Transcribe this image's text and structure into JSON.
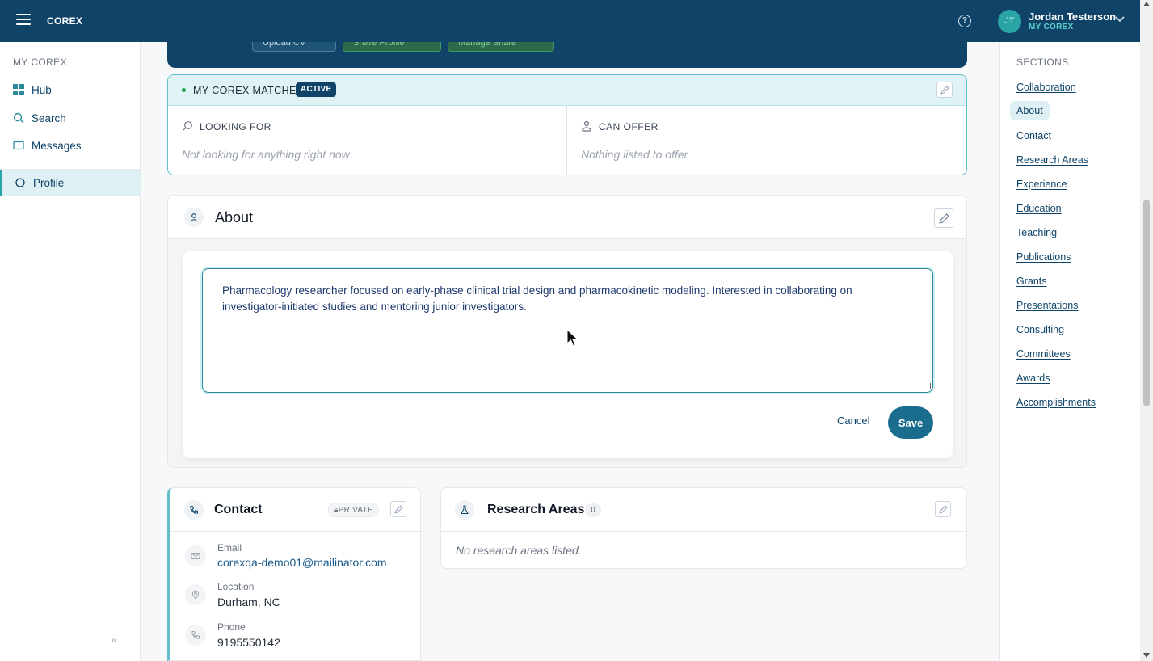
{
  "topbar": {
    "brand": "COREX",
    "user_initials": "JT",
    "user_name": "Jordan Testerson",
    "user_sub": "MY COREX"
  },
  "sidebar": {
    "heading": "MY COREX",
    "items": [
      {
        "label": "Hub",
        "icon": "grid-icon"
      },
      {
        "label": "Search",
        "icon": "search-icon"
      },
      {
        "label": "Messages",
        "icon": "message-icon"
      },
      {
        "label": "Profile",
        "icon": "profile-icon",
        "active": true
      }
    ],
    "collapse": "«"
  },
  "hero": {
    "buttons": [
      "Upload CV",
      "Share Profile",
      "Manage Share"
    ]
  },
  "matches": {
    "title": "MY COREX MATCHES",
    "badge": "ACTIVE",
    "looking_for_label": "LOOKING FOR",
    "looking_for_empty": "Not looking for anything right now",
    "can_offer_label": "CAN OFFER",
    "can_offer_empty": "Nothing listed to offer"
  },
  "about": {
    "title": "About",
    "text": "Pharmacology researcher focused on early-phase clinical trial design and pharmacokinetic modeling. Interested in collaborating on investigator-initiated studies and mentoring junior investigators.",
    "cancel": "Cancel",
    "save": "Save"
  },
  "contact": {
    "title": "Contact",
    "private_badge": "PRIVATE",
    "email_label": "Email",
    "email": "corexqa-demo01@mailinator.com",
    "location_label": "Location",
    "location": "Durham, NC",
    "phone_label": "Phone",
    "phone": "9195550142"
  },
  "research": {
    "title": "Research Areas",
    "count": "0",
    "empty": "No research areas listed."
  },
  "sections": {
    "heading": "SECTIONS",
    "links": [
      "Collaboration",
      "About",
      "Contact",
      "Research Areas",
      "Experience",
      "Education",
      "Teaching",
      "Publications",
      "Grants",
      "Presentations",
      "Consulting",
      "Committees",
      "Awards",
      "Accomplishments"
    ],
    "active": "About"
  },
  "colors": {
    "navy": "#0f4468",
    "teal": "#2aa3a5",
    "accent_button": "#1a6d8c"
  }
}
